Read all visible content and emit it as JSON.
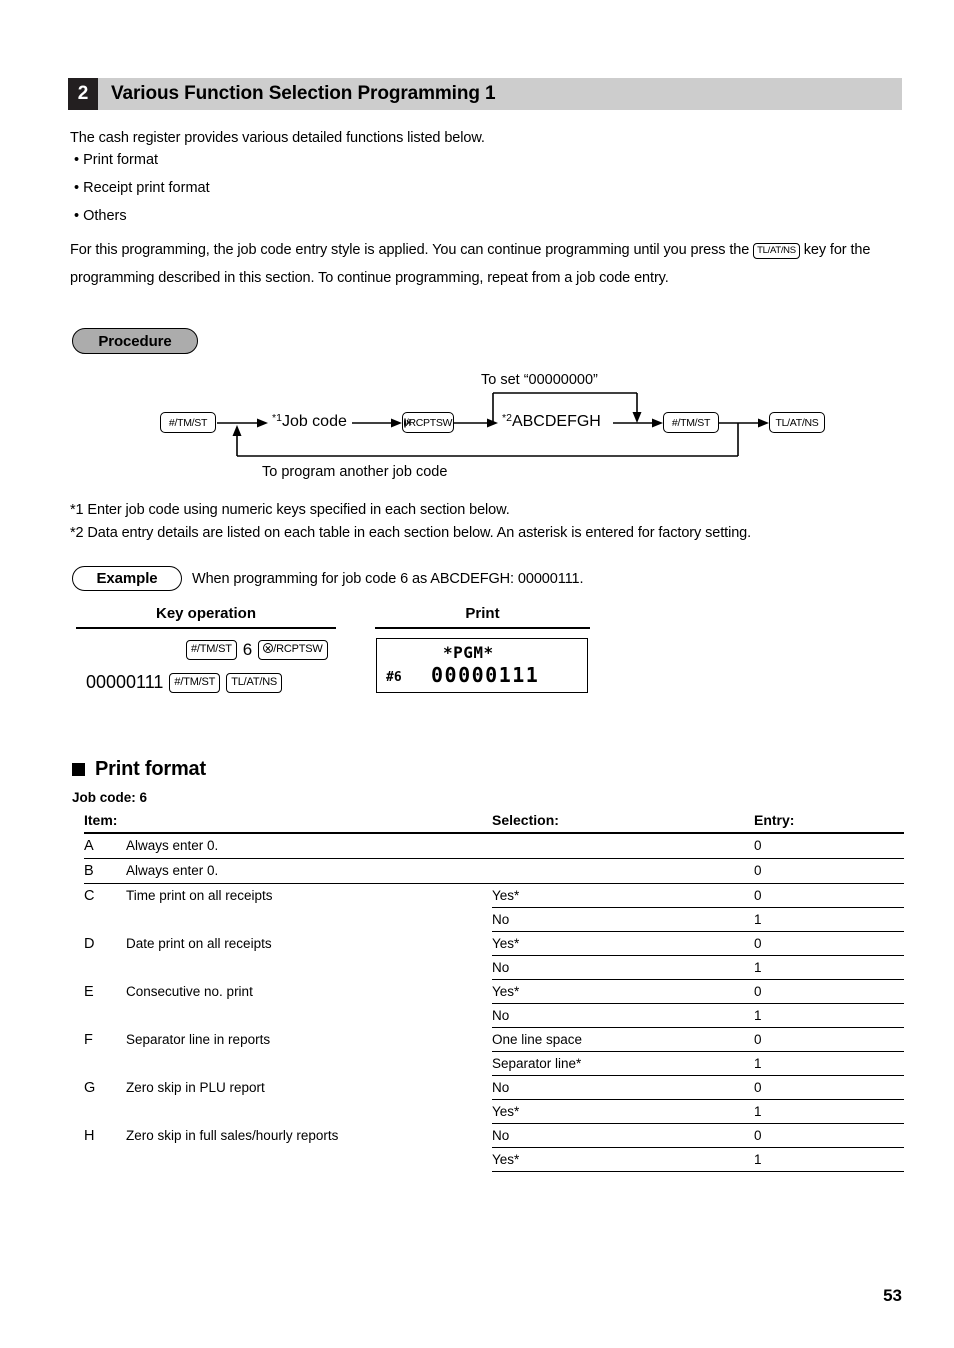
{
  "header": {
    "number": "2",
    "title": "Various Function Selection Programming 1"
  },
  "intro": {
    "lead": "The cash register provides various detailed functions listed below.",
    "bullets": [
      "• Print format",
      "• Receipt print format",
      "• Others"
    ],
    "paragraph_part1": "For this programming, the job code entry style is applied. You can continue programming until you press the",
    "paragraph_key": "TL/AT/NS",
    "paragraph_part2": "key for the programming described in this section. To continue programming, repeat from a job code",
    "paragraph_part3": "entry."
  },
  "procedure": {
    "badge": "Procedure",
    "top_label": "To set “00000000”",
    "bottom_label": "To program another job code",
    "nodes": {
      "key1": "#/TM/ST",
      "jobcode_sup": "*1",
      "jobcode": "Job code",
      "key2_suffix": "/RCPTSW",
      "abcdefgh_sup": "*2",
      "abcdefgh": "ABCDEFGH",
      "key3": "#/TM/ST",
      "key4": "TL/AT/NS"
    }
  },
  "footnotes": {
    "note1": "*1 Enter job code using numeric keys specified in each section below.",
    "note2": "*2 Data entry details are listed on each table in each section below. An asterisk is entered for factory setting."
  },
  "example": {
    "badge": "Example",
    "text": "When programming for job code 6 as ABCDEFGH: 00000111.",
    "col_keyop": "Key operation",
    "col_print": "Print",
    "keyop_line1": {
      "key_a": "#/TM/ST",
      "digit": "6",
      "key_b_suffix": "/RCPTSW"
    },
    "keyop_line2": {
      "number": "00000111",
      "key_a": "#/TM/ST",
      "key_b": "TL/AT/NS"
    },
    "print": {
      "title": "*PGM*",
      "code": "#6",
      "value": "00000111"
    }
  },
  "print_format": {
    "heading": "Print format",
    "job_code": "Job code: 6",
    "columns": {
      "item": "Item:",
      "selection": "Selection:",
      "entry": "Entry:"
    },
    "rows": [
      {
        "item": "A",
        "desc": "Always enter 0.",
        "options": [
          {
            "selection": "",
            "entry": "0"
          }
        ]
      },
      {
        "item": "B",
        "desc": "Always enter 0.",
        "options": [
          {
            "selection": "",
            "entry": "0"
          }
        ]
      },
      {
        "item": "C",
        "desc": "Time print on all receipts",
        "options": [
          {
            "selection": "Yes*",
            "entry": "0"
          },
          {
            "selection": "No",
            "entry": "1"
          }
        ]
      },
      {
        "item": "D",
        "desc": "Date print on all receipts",
        "options": [
          {
            "selection": "Yes*",
            "entry": "0"
          },
          {
            "selection": "No",
            "entry": "1"
          }
        ]
      },
      {
        "item": "E",
        "desc": "Consecutive no. print",
        "options": [
          {
            "selection": "Yes*",
            "entry": "0"
          },
          {
            "selection": "No",
            "entry": "1"
          }
        ]
      },
      {
        "item": "F",
        "desc": "Separator line in reports",
        "options": [
          {
            "selection": "One line space",
            "entry": "0"
          },
          {
            "selection": "Separator line*",
            "entry": "1"
          }
        ]
      },
      {
        "item": "G",
        "desc": "Zero skip in PLU report",
        "options": [
          {
            "selection": "No",
            "entry": "0"
          },
          {
            "selection": "Yes*",
            "entry": "1"
          }
        ]
      },
      {
        "item": "H",
        "desc": "Zero skip in full sales/hourly reports",
        "options": [
          {
            "selection": "No",
            "entry": "0"
          },
          {
            "selection": "Yes*",
            "entry": "1"
          }
        ]
      }
    ]
  },
  "page_number": "53"
}
